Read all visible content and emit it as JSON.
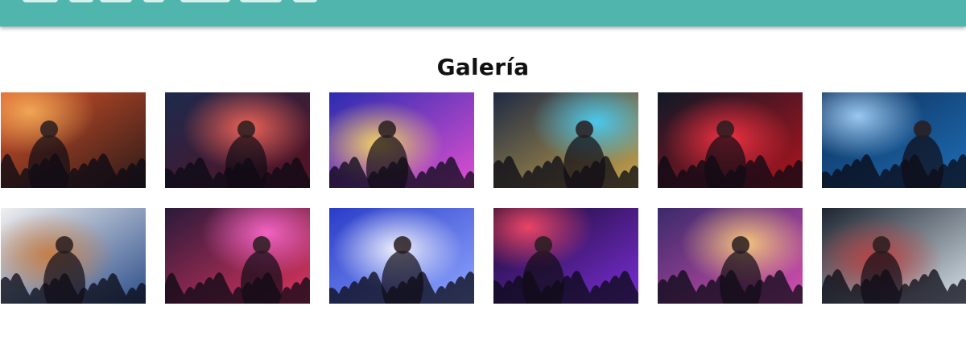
{
  "page": {
    "title": "Galería",
    "accent_color": "#4fb5ad"
  },
  "gallery": {
    "rows": [
      [
        {
          "name": "concert-crowd-smoke",
          "bg1": "#d9522a",
          "bg2": "#2a1a18",
          "glow": "#f7b15a"
        },
        {
          "name": "singer-on-stage",
          "bg1": "#1c2a4d",
          "bg2": "#5a1020",
          "glow": "#ff6a5a"
        },
        {
          "name": "crowd-light-show",
          "bg1": "#2b2cb0",
          "bg2": "#e04fd0",
          "glow": "#ffe35a"
        },
        {
          "name": "dj-turntable",
          "bg1": "#1f2a44",
          "bg2": "#c8a54a",
          "glow": "#46d2ff"
        },
        {
          "name": "guitarist-red-lights",
          "bg1": "#101826",
          "bg2": "#b0141e",
          "glow": "#ff3344"
        },
        {
          "name": "female-dj-blue",
          "bg1": "#0c2d56",
          "bg2": "#1f6fb8",
          "glow": "#a9d7ff"
        }
      ],
      [
        {
          "name": "electric-guitars",
          "bg1": "#f0f0f0",
          "bg2": "#2b4d8a",
          "glow": "#c8793a"
        },
        {
          "name": "dj-laptop-booth",
          "bg1": "#2a1a3a",
          "bg2": "#e0345f",
          "glow": "#ff6ad0"
        },
        {
          "name": "dj-hands-mixer",
          "bg1": "#2a3cc8",
          "bg2": "#8fa6ff",
          "glow": "#ffffff"
        },
        {
          "name": "mixer-purple-glow",
          "bg1": "#160a2a",
          "bg2": "#7b2ed8",
          "glow": "#ff4a6a"
        },
        {
          "name": "two-guitarists-stage",
          "bg1": "#3a2a6a",
          "bg2": "#d84fb0",
          "glow": "#ffd27a"
        },
        {
          "name": "performer-smoke",
          "bg1": "#1c2530",
          "bg2": "#d8e2ea",
          "glow": "#c23a3a"
        }
      ]
    ]
  }
}
